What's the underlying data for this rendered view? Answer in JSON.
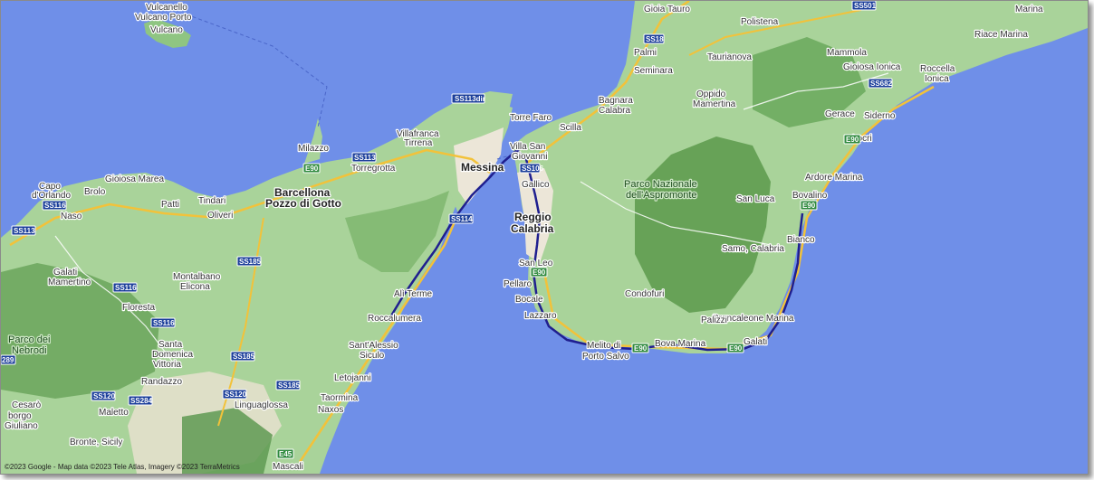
{
  "map": {
    "attribution": "©2023 Google - Map data ©2023 Tele Atlas, Imagery ©2023 TerraMetrics",
    "colors": {
      "sea": "#6f8fe8",
      "land": "#a8d49a",
      "forest": "#6aa85e",
      "urban": "#e9e3d4",
      "highway": "#f3c13a",
      "route": "#1f1f8f"
    },
    "labels": {
      "vulcanello": "Vulcanello",
      "vulcano_porto": "Vulcano Porto",
      "vulcano": "Vulcano",
      "milazzo": "Milazzo",
      "villafranca": "Villafranca",
      "tirrena": "Tirrena",
      "torregrotta": "Torregrotta",
      "messina": "Messina",
      "torre_faro": "Torre Faro",
      "capo": "Capo",
      "d_orlando": "d'Orlando",
      "brolo": "Brolo",
      "gioiosa_marea": "Gioiosa Marea",
      "patti": "Patti",
      "tindari": "Tindari",
      "barcellona": "Barcellona",
      "pozzo_di_gotto": "Pozzo di Gotto",
      "oliveri": "Oliveri",
      "naso": "Naso",
      "montalbano": "Montalbano",
      "elicona": "Elicona",
      "galati": "Galati",
      "mamertino": "Mamertino",
      "floresta": "Floresta",
      "parco_dei": "Parco dei",
      "nebrodi": "Nebrodi",
      "santa": "Santa",
      "domenica": "Domenica",
      "vittoria": "Vittoria",
      "randazzo": "Randazzo",
      "cesaro": "Cesarò",
      "borgo": "borgo",
      "giuliano": "Giuliano",
      "maletto": "Maletto",
      "bronte": "Bronte, Sicily",
      "linguaglossa": "Linguaglossa",
      "ali_terme": "Alì Terme",
      "roccalumera": "Roccalumera",
      "santalessio": "Sant'Alessio",
      "siculo": "Siculo",
      "letojanni": "Letojanni",
      "taormina": "Taormina",
      "naxos": "Naxos",
      "mascali": "Mascali",
      "gioia_tauro": "Gioia Tauro",
      "palmi": "Palmi",
      "seminara": "Seminara",
      "bagnara": "Bagnara",
      "calabra": "Calabra",
      "scilla": "Scilla",
      "villa_san": "Villa San",
      "giovanni": "Giovanni",
      "gallico": "Gallico",
      "reggio": "Reggio",
      "calabria": "Calabria",
      "san_leo": "San Leo",
      "pellaro": "Pellaro",
      "bocale": "Bocale",
      "lazzaro": "Lazzaro",
      "melito": "Melito di",
      "porto_salvo": "Porto Salvo",
      "bova_marina": "Bova Marina",
      "galati_cal": "Galati",
      "brancaleone": "Brancaleone Marina",
      "palizzi": "Palizzi",
      "condofuri": "Condofuri",
      "polistena": "Polistena",
      "taurianova": "Taurianova",
      "oppido": "Oppido",
      "mamertina": "Mamertina",
      "mammola": "Mammola",
      "gioiosa_ionica": "Gioiosa Ionica",
      "roccella": "Roccella",
      "ionica": "Ionica",
      "riace": "Riace Marina",
      "marina": "Marina",
      "gerace": "Gerace",
      "siderno": "Siderno",
      "locri": "Locri",
      "ardore": "Ardore Marina",
      "bovalino": "Bovalino",
      "san_luca": "San Luca",
      "samo": "Samo, Calabria",
      "bianco": "Bianco",
      "parco_nazionale": "Parco Nazionale",
      "dell_aspromonte": "dell'Aspromonte"
    },
    "road_shields": {
      "ss113dir": "SS113dir",
      "ss113_a": "SS113",
      "ss113_b": "SS113",
      "ss116_a": "SS116",
      "ss116_b": "SS116",
      "ss116_c": "SS116",
      "ss185_a": "SS185",
      "ss185_b": "SS185",
      "ss185_c": "SS185",
      "ss114": "SS114",
      "ss120_a": "SS120",
      "ss120_b": "SS120",
      "ss284": "SS284",
      "ss18": "SS18",
      "ss501": "SS501",
      "ss682": "SS682",
      "ss106": "SS106",
      "ss289": "289",
      "e90_a": "E90",
      "e90_b": "E90",
      "e90_c": "E90",
      "e90_d": "E90",
      "e90_e": "E90",
      "e90_f": "E90",
      "e45": "E45"
    }
  }
}
